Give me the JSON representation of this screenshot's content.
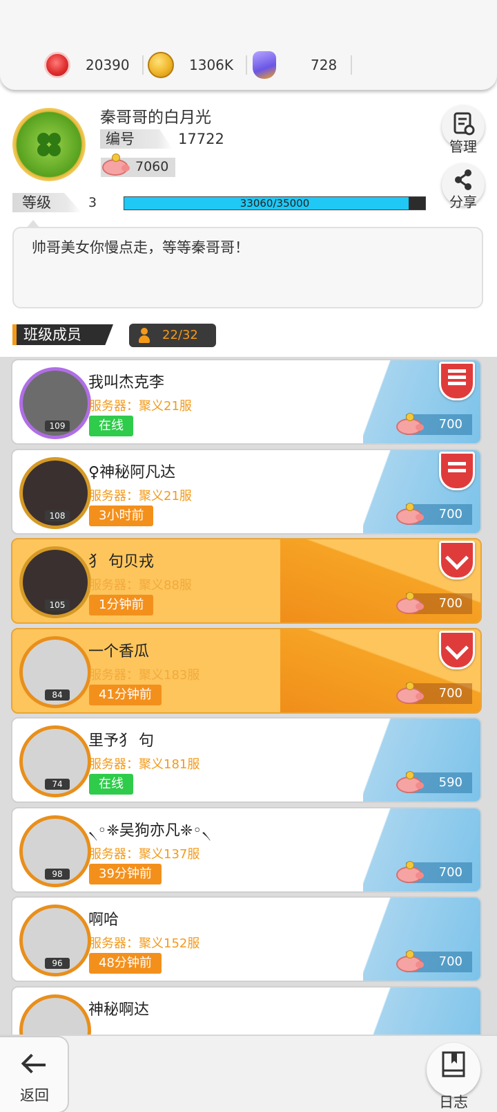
{
  "resources": [
    {
      "icon": "red-gem-coin-icon",
      "value": "20390"
    },
    {
      "icon": "gold-coin-icon",
      "value": "1306K"
    },
    {
      "icon": "crystal-key-icon",
      "value": "728"
    }
  ],
  "profile": {
    "name": "秦哥哥的白月光",
    "id_label": "编号",
    "id_value": "17722",
    "piggy_value": "7060",
    "level_label": "等级",
    "level_value": "3",
    "xp_text": "33060/35000",
    "xp_fraction": 0.9446,
    "motto": "帅哥美女你慢点走，等等秦哥哥！"
  },
  "actions": {
    "manage_label": "管理",
    "share_label": "分享"
  },
  "members_section": {
    "title": "班级成员",
    "count": "22/32"
  },
  "members": [
    {
      "name": "我叫杰克李",
      "server": "服务器：聚义21服",
      "status": "在线",
      "online": true,
      "level": "109",
      "coins": "700",
      "badge": "bars-star",
      "style": "white",
      "ring": "purple"
    },
    {
      "name": "♀神秘阿凡达",
      "server": "服务器：聚义21服",
      "status": "3小时前",
      "online": false,
      "level": "108",
      "coins": "700",
      "badge": "bars",
      "style": "white",
      "ring": "gold"
    },
    {
      "name": "犭 句贝戎",
      "server": "服务器：聚义88服",
      "status": "1分钟前",
      "online": false,
      "level": "105",
      "coins": "700",
      "badge": "chevron",
      "style": "gold",
      "ring": "gold"
    },
    {
      "name": "一个香瓜",
      "server": "服务器：聚义183服",
      "status": "41分钟前",
      "online": false,
      "level": "84",
      "coins": "700",
      "badge": "chevron",
      "style": "gold",
      "ring": "orange"
    },
    {
      "name": "里予犭 句",
      "server": "服务器：聚义181服",
      "status": "在线",
      "online": true,
      "level": "74",
      "coins": "590",
      "badge": "",
      "style": "white",
      "ring": "orange"
    },
    {
      "name": "৲◦❈吴狗亦凡❈◦৲",
      "server": "服务器：聚义137服",
      "status": "39分钟前",
      "online": false,
      "level": "98",
      "coins": "700",
      "badge": "",
      "style": "white",
      "ring": "orange"
    },
    {
      "name": "啊哈",
      "server": "服务器：聚义152服",
      "status": "48分钟前",
      "online": false,
      "level": "96",
      "coins": "700",
      "badge": "",
      "style": "white",
      "ring": "orange"
    },
    {
      "name": "神秘啊达",
      "server": "",
      "status": "",
      "online": false,
      "level": "",
      "coins": "",
      "badge": "",
      "style": "white",
      "ring": "orange"
    }
  ],
  "bottom": {
    "back_label": "返回",
    "log_label": "日志"
  }
}
